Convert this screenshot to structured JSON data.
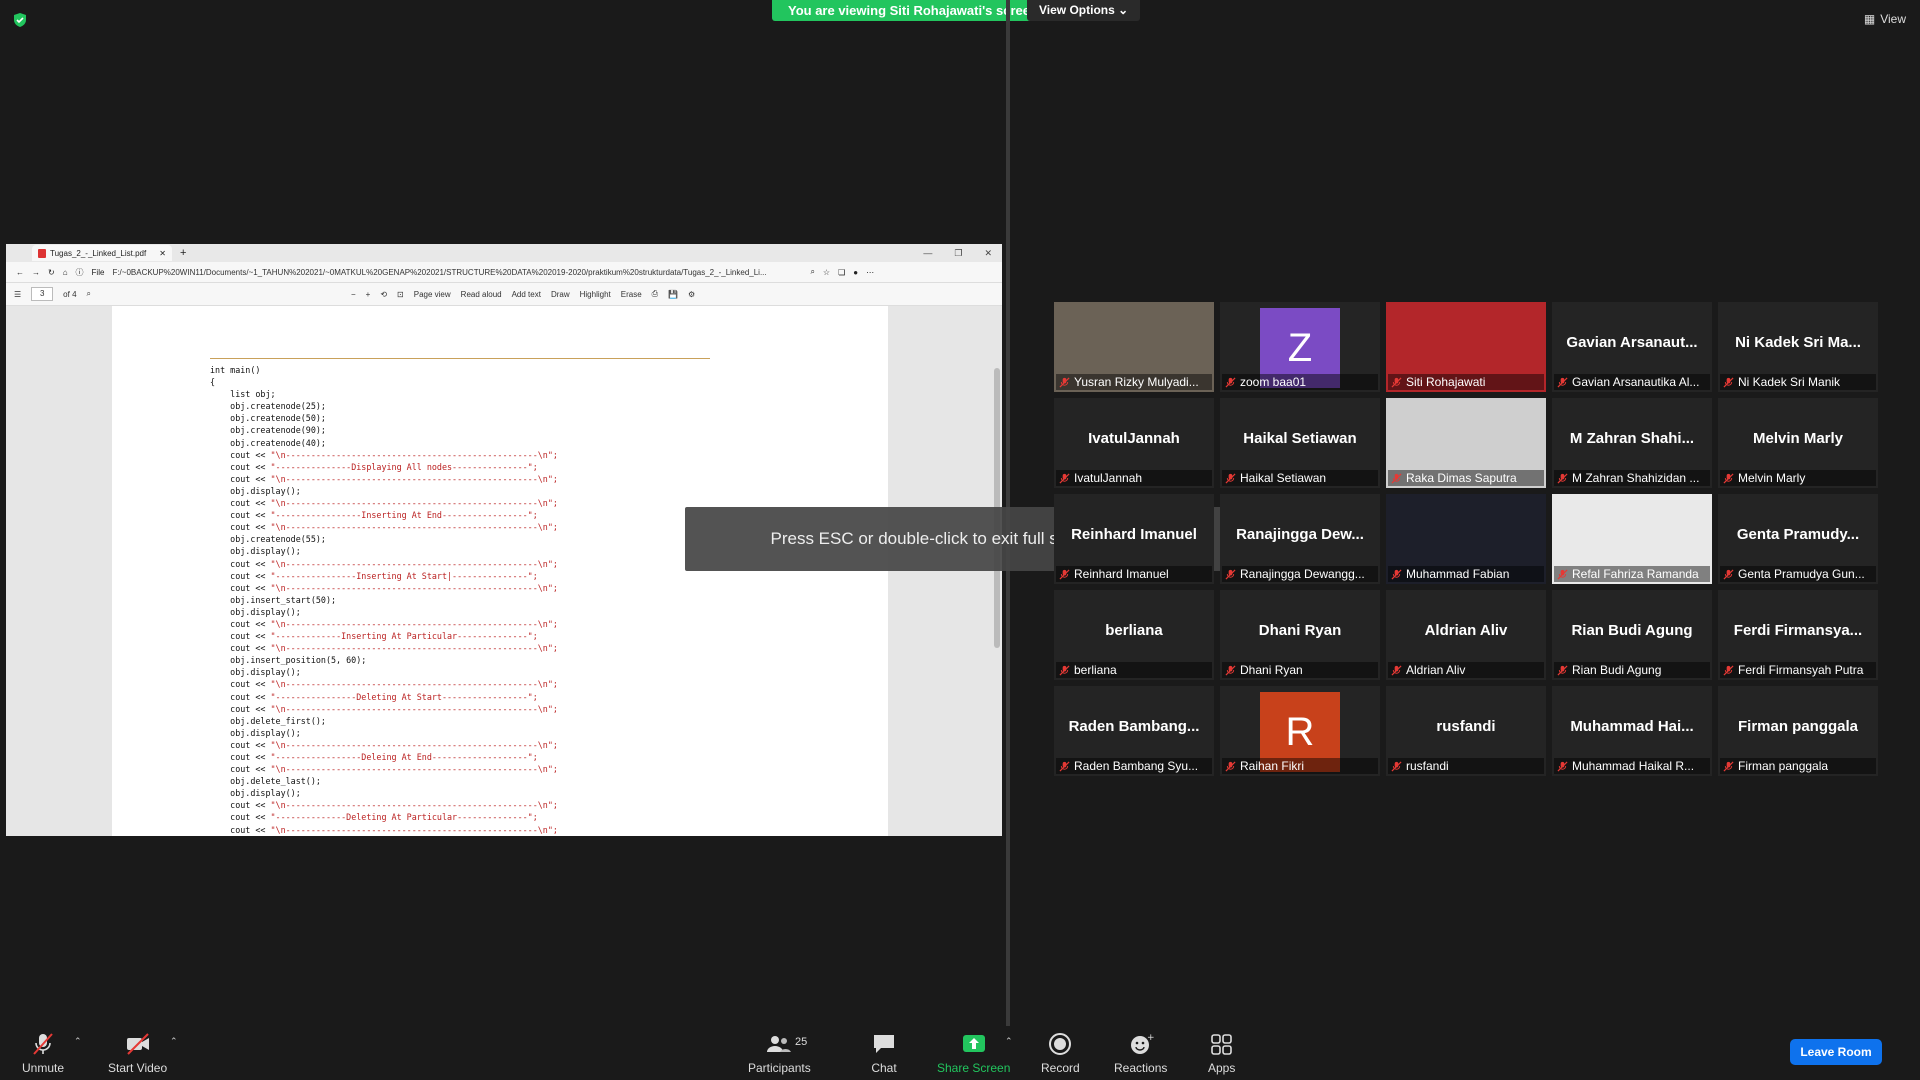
{
  "meeting": {
    "banner": "You are viewing Siti Rohajawati's screen",
    "view_options": "View Options",
    "view_label": "View",
    "toast": "Press ESC or double-click to exit full screen mode"
  },
  "browser": {
    "tab_title": "Tugas_2_-_Linked_List.pdf",
    "url_prefix": "File",
    "url": "F:/~0BACKUP%20WIN11/Documents/~1_TAHUN%202021/~0MATKUL%20GENAP%202021/STRUCTURE%20DATA%202019-2020/praktikum%20strukturdata/Tugas_2_-_Linked_Li...",
    "page_num": "3",
    "page_of": "of 4",
    "tools": [
      "Page view",
      "Read aloud",
      "Add text",
      "Draw",
      "Highlight",
      "Erase"
    ]
  },
  "code_lines": [
    "int main()",
    "{",
    "    list obj;",
    "    obj.createnode(25);",
    "    obj.createnode(50);",
    "    obj.createnode(90);",
    "    obj.createnode(40);",
    "    cout << \"\\n--------------------------------------------------\\n\";",
    "    cout << \"---------------Displaying All nodes---------------\";",
    "    cout << \"\\n--------------------------------------------------\\n\";",
    "    obj.display();",
    "    cout << \"\\n--------------------------------------------------\\n\";",
    "    cout << \"-----------------Inserting At End-----------------\";",
    "    cout << \"\\n--------------------------------------------------\\n\";",
    "    obj.createnode(55);",
    "    obj.display();",
    "    cout << \"\\n--------------------------------------------------\\n\";",
    "    cout << \"----------------Inserting At Start|---------------\";",
    "    cout << \"\\n--------------------------------------------------\\n\";",
    "    obj.insert_start(50);",
    "    obj.display();",
    "    cout << \"\\n--------------------------------------------------\\n\";",
    "    cout << \"-------------Inserting At Particular--------------\";",
    "    cout << \"\\n--------------------------------------------------\\n\";",
    "    obj.insert_position(5, 60);",
    "    obj.display();",
    "    cout << \"\\n--------------------------------------------------\\n\";",
    "    cout << \"----------------Deleting At Start-----------------\";",
    "    cout << \"\\n--------------------------------------------------\\n\";",
    "    obj.delete_first();",
    "    obj.display();",
    "    cout << \"\\n--------------------------------------------------\\n\";",
    "    cout << \"-----------------Deleing At End-------------------\";",
    "    cout << \"\\n--------------------------------------------------\\n\";",
    "    obj.delete_last();",
    "    obj.display();",
    "    cout << \"\\n--------------------------------------------------\\n\";",
    "    cout << \"--------------Deleting At Particular--------------\";",
    "    cout << \"\\n--------------------------------------------------\\n\";"
  ],
  "participants": [
    {
      "name": "Yusran Rizky Mulyadi...",
      "display": "",
      "type": "video",
      "vcolor": "#6b6256"
    },
    {
      "name": "zoom baa01",
      "display": "Z",
      "type": "avatar",
      "color": "#7b4bc4"
    },
    {
      "name": "Siti Rohajawati",
      "display": "",
      "type": "video",
      "vcolor": "#b3262a",
      "active": true
    },
    {
      "name": "Gavian Arsanautika Al...",
      "display": "Gavian  Arsanaut...",
      "type": "name"
    },
    {
      "name": "Ni Kadek Sri Manik",
      "display": "Ni  Kadek  Sri  Ma...",
      "type": "name"
    },
    {
      "name": "IvatulJannah",
      "display": "IvatulJannah",
      "type": "name"
    },
    {
      "name": "Haikal Setiawan",
      "display": "Haikal Setiawan",
      "type": "name"
    },
    {
      "name": "Raka Dimas Saputra",
      "display": "",
      "type": "video",
      "vcolor": "#cfcfcf"
    },
    {
      "name": "M Zahran Shahizidan ...",
      "display": "M  Zahran  Shahi...",
      "type": "name"
    },
    {
      "name": "Melvin Marly",
      "display": "Melvin Marly",
      "type": "name"
    },
    {
      "name": "Reinhard Imanuel",
      "display": "Reinhard Imanuel",
      "type": "name"
    },
    {
      "name": "Ranajingga Dewangg...",
      "display": "Ranajingga  Dew...",
      "type": "name"
    },
    {
      "name": "Muhammad Fabian",
      "display": "",
      "type": "video",
      "vcolor": "#1d1f2a"
    },
    {
      "name": "Refal Fahriza Ramanda",
      "display": "",
      "type": "video",
      "vcolor": "#e9e9e9"
    },
    {
      "name": "Genta Pramudya Gun...",
      "display": "Genta  Pramudy...",
      "type": "name"
    },
    {
      "name": "berliana",
      "display": "berliana",
      "type": "name"
    },
    {
      "name": "Dhani Ryan",
      "display": "Dhani Ryan",
      "type": "name"
    },
    {
      "name": "Aldrian Aliv",
      "display": "Aldrian Aliv",
      "type": "name"
    },
    {
      "name": "Rian Budi Agung",
      "display": "Rian Budi Agung",
      "type": "name"
    },
    {
      "name": "Ferdi Firmansyah Putra",
      "display": "Ferdi  Firmansya...",
      "type": "name"
    },
    {
      "name": "Raden Bambang Syu...",
      "display": "Raden  Bambang...",
      "type": "name"
    },
    {
      "name": "Raihan Fikri",
      "display": "R",
      "type": "avatar",
      "color": "#c8411b"
    },
    {
      "name": "rusfandi",
      "display": "rusfandi",
      "type": "name"
    },
    {
      "name": "Muhammad Haikal R...",
      "display": "Muhammad  Hai...",
      "type": "name"
    },
    {
      "name": "Firman panggala",
      "display": "Firman panggala",
      "type": "name"
    }
  ],
  "toolbar": {
    "unmute": "Unmute",
    "start_video": "Start Video",
    "participants": "Participants",
    "participants_count": "25",
    "chat": "Chat",
    "share_screen": "Share Screen",
    "record": "Record",
    "reactions": "Reactions",
    "apps": "Apps",
    "leave": "Leave Room"
  },
  "colors": {
    "share_green": "#22c55e",
    "leave_blue": "#0e72ed",
    "active_border": "#f5c518"
  }
}
